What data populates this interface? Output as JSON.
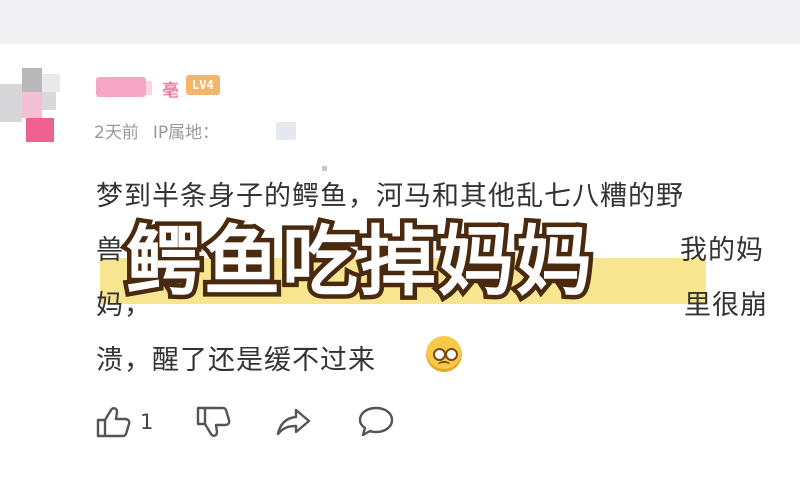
{
  "comment": {
    "username_visible_char": "亳",
    "level_badge": "LV4",
    "time": "2天前",
    "ip_label": "IP属地：",
    "lines": [
      "梦到半条身子的鳄鱼，河马和其他乱七八糟的野",
      "兽，",
      "妈，",
      "溃，醒了还是缓不过来"
    ],
    "line2_right": "我的妈",
    "line3_right": "里很崩",
    "emoji": "sad-face-emoji"
  },
  "overlay": {
    "title": "鳄鱼吃掉妈妈",
    "highlight_color": "#f7e48a",
    "text_color": "#ffffff",
    "stroke_color": "#4a2a0e"
  },
  "actions": {
    "like_count": "1",
    "icons": [
      "thumbs-up-icon",
      "thumbs-down-icon",
      "share-icon",
      "comment-icon"
    ]
  }
}
